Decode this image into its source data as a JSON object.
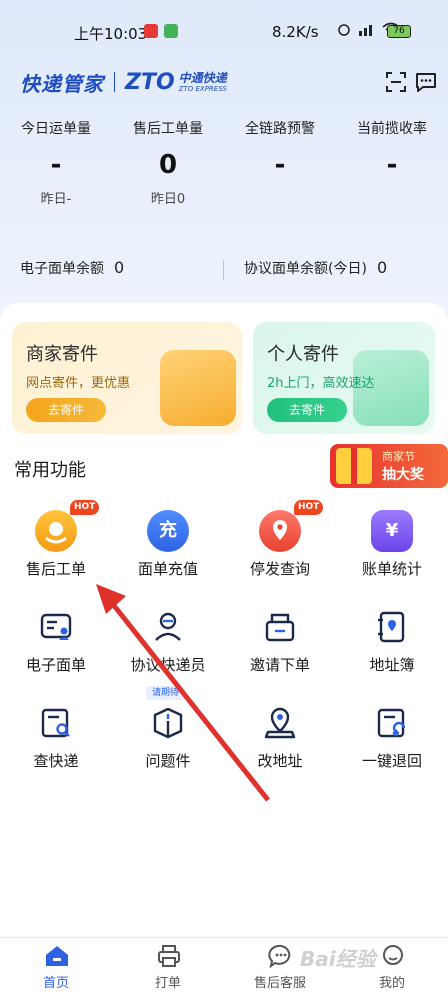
{
  "status_bar": {
    "time": "上午10:03",
    "network_speed": "8.2K/s",
    "battery": "76"
  },
  "header": {
    "app_name": "快递管家",
    "brand_mark": "ZTO",
    "brand_cn": "中通快递",
    "brand_en": "ZTO EXPRESS",
    "icons": [
      "scan-icon",
      "message-icon"
    ]
  },
  "stats": [
    {
      "label": "今日运单量",
      "value": "-",
      "sub": "昨日-"
    },
    {
      "label": "售后工单量",
      "value": "0",
      "sub": "昨日0"
    },
    {
      "label": "全链路预警",
      "value": "-",
      "sub": ""
    },
    {
      "label": "当前揽收率",
      "value": "-",
      "sub": ""
    }
  ],
  "balances": {
    "e_waybill_label": "电子面单余额",
    "e_waybill_value": "0",
    "agreement_label": "协议面单余额(今日)",
    "agreement_value": "0"
  },
  "cards": {
    "merchant": {
      "title": "商家寄件",
      "subtitle": "网点寄件，更优惠",
      "button": "去寄件"
    },
    "personal": {
      "title": "个人寄件",
      "subtitle": "2h上门，高效速达",
      "button": "去寄件"
    }
  },
  "section_title": "常用功能",
  "promo": {
    "line1": "商家节",
    "line2": "抽大奖"
  },
  "functions": [
    {
      "label": "售后工单",
      "icon": "headset-icon",
      "badge": "HOT"
    },
    {
      "label": "面单充值",
      "icon": "recharge-icon",
      "glyph": "充"
    },
    {
      "label": "停发查询",
      "icon": "location-pin-icon",
      "badge": "HOT"
    },
    {
      "label": "账单统计",
      "icon": "bill-icon",
      "glyph": "¥"
    },
    {
      "label": "电子面单",
      "icon": "e-waybill-icon"
    },
    {
      "label": "协议快递员",
      "icon": "courier-icon"
    },
    {
      "label": "邀请下单",
      "icon": "invite-order-icon"
    },
    {
      "label": "地址簿",
      "icon": "address-book-icon"
    },
    {
      "label": "查快递",
      "icon": "track-package-icon"
    },
    {
      "label": "问题件",
      "icon": "problem-package-icon",
      "tag": "请期待"
    },
    {
      "label": "改地址",
      "icon": "change-address-icon"
    },
    {
      "label": "一键退回",
      "icon": "return-icon"
    }
  ],
  "bottom_nav": [
    {
      "label": "首页",
      "icon": "home-icon",
      "active": true
    },
    {
      "label": "打单",
      "icon": "printer-icon"
    },
    {
      "label": "售后客服",
      "icon": "chat-icon"
    },
    {
      "label": "我的",
      "icon": "profile-icon"
    }
  ],
  "watermark": "Bai经验",
  "colors": {
    "primary": "#2f62e3",
    "hot_badge": "#f0451f",
    "merchant_accent": "#f4a51c",
    "personal_accent": "#22c07d",
    "arrow": "#e0312c"
  }
}
